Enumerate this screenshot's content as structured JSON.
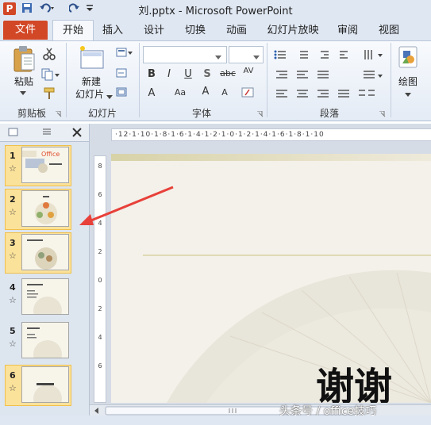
{
  "window": {
    "title": "刘.pptx - Microsoft PowerPoint",
    "app_icon": "P"
  },
  "qat": {
    "save_icon": "save-icon",
    "undo_icon": "undo-icon",
    "redo_icon": "redo-icon",
    "customize_icon": "customize-icon"
  },
  "tabs": [
    {
      "label": "文件"
    },
    {
      "label": "开始"
    },
    {
      "label": "插入"
    },
    {
      "label": "设计"
    },
    {
      "label": "切换"
    },
    {
      "label": "动画"
    },
    {
      "label": "幻灯片放映"
    },
    {
      "label": "审阅"
    },
    {
      "label": "视图"
    }
  ],
  "ribbon": {
    "clipboard": {
      "group": "剪贴板",
      "paste": "粘贴"
    },
    "slides": {
      "group": "幻灯片",
      "new_line1": "新建",
      "new_line2": "幻灯片"
    },
    "font": {
      "group": "字体"
    },
    "paragraph": {
      "group": "段落"
    },
    "drawing": {
      "label": "绘图"
    }
  },
  "slides": [
    {
      "num": "1",
      "star": "☆"
    },
    {
      "num": "2",
      "star": "☆"
    },
    {
      "num": "3",
      "star": "☆"
    },
    {
      "num": "4",
      "star": "☆"
    },
    {
      "num": "5",
      "star": "☆"
    },
    {
      "num": "6",
      "star": "☆"
    }
  ],
  "thumb1_office": "Office",
  "ruler": {
    "h": "·12·1·10·1·8·1·6·1·4·1·2·1·0·1·2·1·4·1·6·1·8·1·10",
    "v": [
      "8",
      "6",
      "4",
      "2",
      "0",
      "2",
      "4",
      "6",
      "8"
    ]
  },
  "slide_text": "谢谢",
  "watermark": "头条号 / office技巧",
  "colors": {
    "accent": "#d24726",
    "arrow": "#e8403a",
    "selected": "#fbe29a"
  }
}
